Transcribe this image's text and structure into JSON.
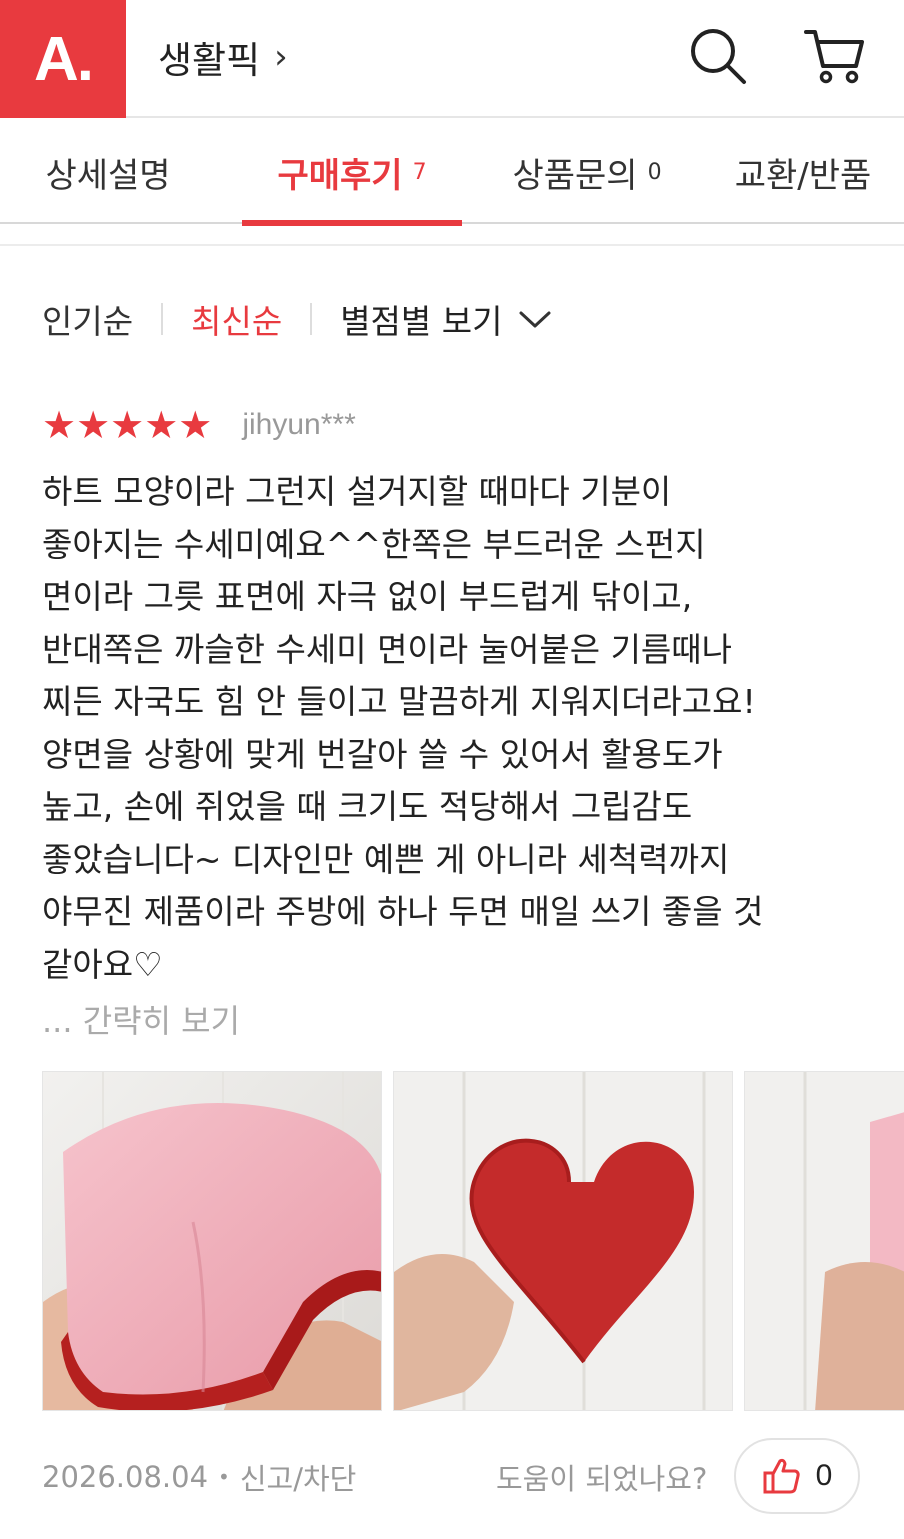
{
  "header": {
    "logo_text": "A.",
    "category_label": "생활픽",
    "chevron": "›",
    "brand_color": "#e83a3f"
  },
  "tabs": [
    {
      "label": "상세설명",
      "count": null,
      "active": false
    },
    {
      "label": "구매후기",
      "count": "7",
      "active": true
    },
    {
      "label": "상품문의",
      "count": "0",
      "active": false
    },
    {
      "label": "교환/반품",
      "count": null,
      "active": false
    }
  ],
  "sort": {
    "popular": "인기순",
    "latest": "최신순",
    "by_rating": "별점별 보기"
  },
  "review": {
    "rating": 5,
    "stars": "★★★★★",
    "user": "jihyun***",
    "text": "하트 모양이라 그런지 설거지할 때마다 기분이\n좋아지는 수세미예요^^한쪽은 부드러운 스펀지\n면이라 그릇 표면에 자극 없이 부드럽게 닦이고,\n반대쪽은 까슬한 수세미 면이라 눌어붙은 기름때나\n찌든 자국도 힘 안 들이고 말끔하게 지워지더라고요!\n양면을 상황에 맞게 번갈아 쓸 수 있어서 활용도가\n높고, 손에 쥐었을 때 크기도 적당해서 그립감도\n좋았습니다~ 디자인만 예쁜 게 아니라 세척력까지\n야무진 제품이라 주방에 하나 두면 매일 쓰기 좋을 것\n같아요♡",
    "collapse_label": "... 간략히 보기",
    "date": "2026.08.04",
    "dot": "•",
    "report_label": "신고/차단",
    "helpful_question": "도움이 되었나요?",
    "like_count": "0"
  },
  "photos": [
    {
      "name": "pink-sponge-side"
    },
    {
      "name": "red-heart-scrubber"
    },
    {
      "name": "pink-sponge-partial"
    }
  ],
  "icons": [
    "search-icon",
    "cart-icon",
    "chevron-down-icon",
    "thumbs-up-icon",
    "chevron-right-icon"
  ]
}
